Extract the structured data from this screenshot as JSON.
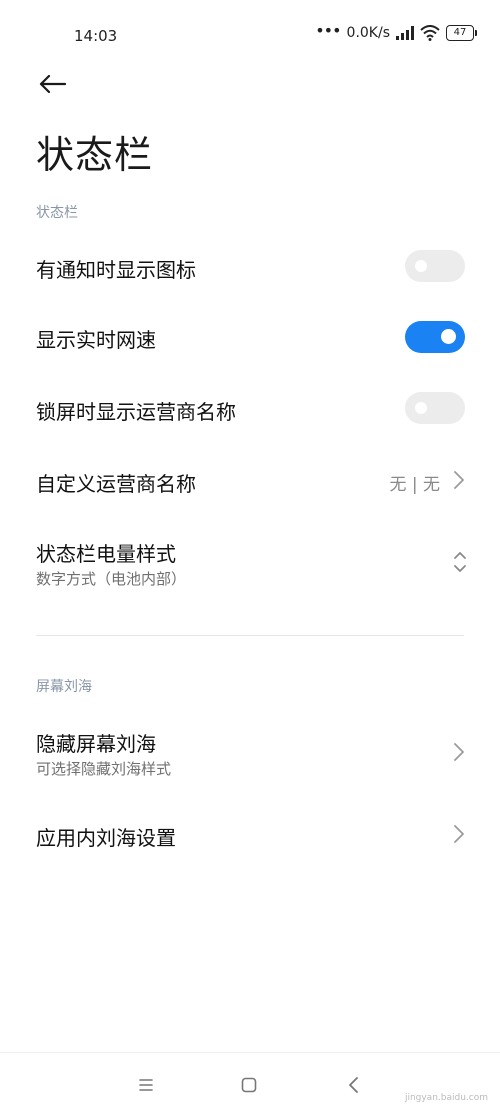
{
  "status_bar": {
    "time": "14:03",
    "net_speed": "0.0K/s",
    "battery": "47"
  },
  "header": {
    "title": "状态栏"
  },
  "sections": {
    "status_bar_label": "状态栏",
    "notch_label": "屏幕刘海"
  },
  "rows": {
    "notify_icons": {
      "title": "有通知时显示图标",
      "enabled": false
    },
    "realtime_speed": {
      "title": "显示实时网速",
      "enabled": true
    },
    "lock_carrier": {
      "title": "锁屏时显示运营商名称",
      "enabled": false
    },
    "custom_carrier": {
      "title": "自定义运营商名称",
      "value": "无 | 无"
    },
    "battery_style": {
      "title": "状态栏电量样式",
      "subtitle": "数字方式（电池内部）"
    },
    "hide_notch": {
      "title": "隐藏屏幕刘海",
      "subtitle": "可选择隐藏刘海样式"
    },
    "app_notch": {
      "title": "应用内刘海设置"
    }
  },
  "colors": {
    "accent": "#1a82f2",
    "toggle_off": "#ececec",
    "section_label": "#8a96a8"
  },
  "icons": {
    "back": "arrow-left-icon",
    "menu": "menu-icon",
    "home": "square-icon",
    "nav_back": "chevron-left-icon"
  },
  "watermark": "jingyan.baidu.com"
}
